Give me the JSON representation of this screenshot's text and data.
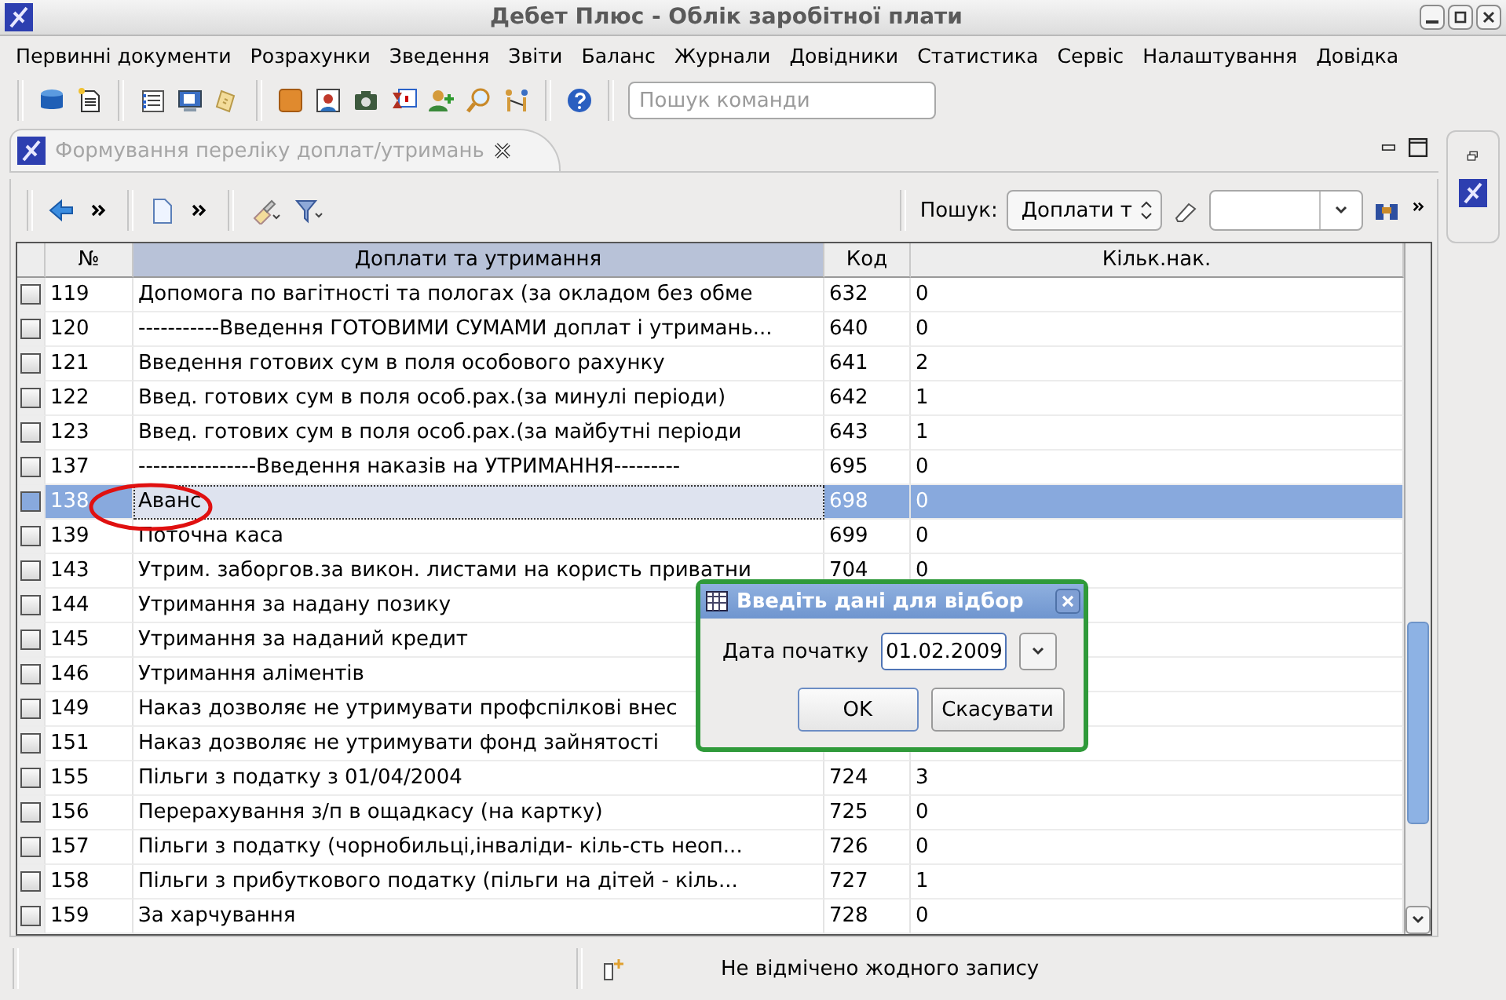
{
  "window": {
    "title": "Дебет Плюс - Облік заробітної плати"
  },
  "menu": [
    "Первинні документи",
    "Розрахунки",
    "Зведення",
    "Звіти",
    "Баланс",
    "Журнали",
    "Довідники",
    "Статистика",
    "Сервіс",
    "Налаштування",
    "Довідка"
  ],
  "command_search": {
    "placeholder": "Пошук команди"
  },
  "editor_tab": {
    "title": "Формування переліку доплат/утримань",
    "selected": true
  },
  "search": {
    "label": "Пошук:",
    "field": "Доплати т"
  },
  "table": {
    "columns": [
      "№",
      "Доплати та утримання",
      "Код",
      "Кільк.нак."
    ],
    "rows": [
      {
        "number": "119",
        "name": "Допомога по вагітності та пологах (за окладом без обме",
        "code": "632",
        "count": "0",
        "selected": false
      },
      {
        "number": "120",
        "name": "-----------Введення ГОТОВИМИ СУМАМИ доплат і утримань...",
        "code": "640",
        "count": "0",
        "selected": false
      },
      {
        "number": "121",
        "name": "Введення готових сум в поля особового рахунку",
        "code": "641",
        "count": "2",
        "selected": false
      },
      {
        "number": "122",
        "name": "Введ. готових сум в поля особ.рах.(за минулі періоди)",
        "code": "642",
        "count": "1",
        "selected": false
      },
      {
        "number": "123",
        "name": "Введ. готових сум в поля особ.рах.(за майбутні періоди",
        "code": "643",
        "count": "1",
        "selected": false
      },
      {
        "number": "137",
        "name": "----------------Введення наказів на УТРИМАННЯ---------",
        "code": "695",
        "count": "0",
        "selected": false
      },
      {
        "number": "138",
        "name": "Аванс",
        "code": "698",
        "count": "0",
        "selected": true
      },
      {
        "number": "139",
        "name": "Поточна каса",
        "code": "699",
        "count": "0",
        "selected": false
      },
      {
        "number": "143",
        "name": "Утрим. заборгов.за викон. листами на користь приватни",
        "code": "704",
        "count": "0",
        "selected": false
      },
      {
        "number": "144",
        "name": "Утримання за надану позику",
        "selected": false
      },
      {
        "number": "145",
        "name": "Утримання за наданий кредит",
        "selected": false
      },
      {
        "number": "146",
        "name": "Утримання аліментів",
        "selected": false
      },
      {
        "number": "149",
        "name": "Наказ дозволяє не утримувати профспілкові внес",
        "selected": false
      },
      {
        "number": "151",
        "name": "Наказ дозволяє не утримувати фонд зайнятості",
        "selected": false
      },
      {
        "number": "155",
        "name": "Пільги з податку з 01/04/2004",
        "code": "724",
        "count": "3",
        "selected": false
      },
      {
        "number": "156",
        "name": "Перерахування з/п в ощадкасу (на картку)",
        "code": "725",
        "count": "0",
        "selected": false
      },
      {
        "number": "157",
        "name": "Пільги з податку (чорнобильці,інваліди- кіль-сть неоп...",
        "code": "726",
        "count": "0",
        "selected": false
      },
      {
        "number": "158",
        "name": "Пільги з прибуткового податку (пільги на дітей - кіль...",
        "code": "727",
        "count": "1",
        "selected": false
      },
      {
        "number": "159",
        "name": "За харчування",
        "code": "728",
        "count": "0",
        "selected": false
      }
    ]
  },
  "dialog": {
    "title": "Введіть дані для відбор",
    "label": "Дата початку",
    "value": "01.02.2009",
    "buttons": [
      "OK",
      "Скасувати"
    ]
  },
  "status_bar": {
    "message": "Не відмічено жодного запису"
  }
}
